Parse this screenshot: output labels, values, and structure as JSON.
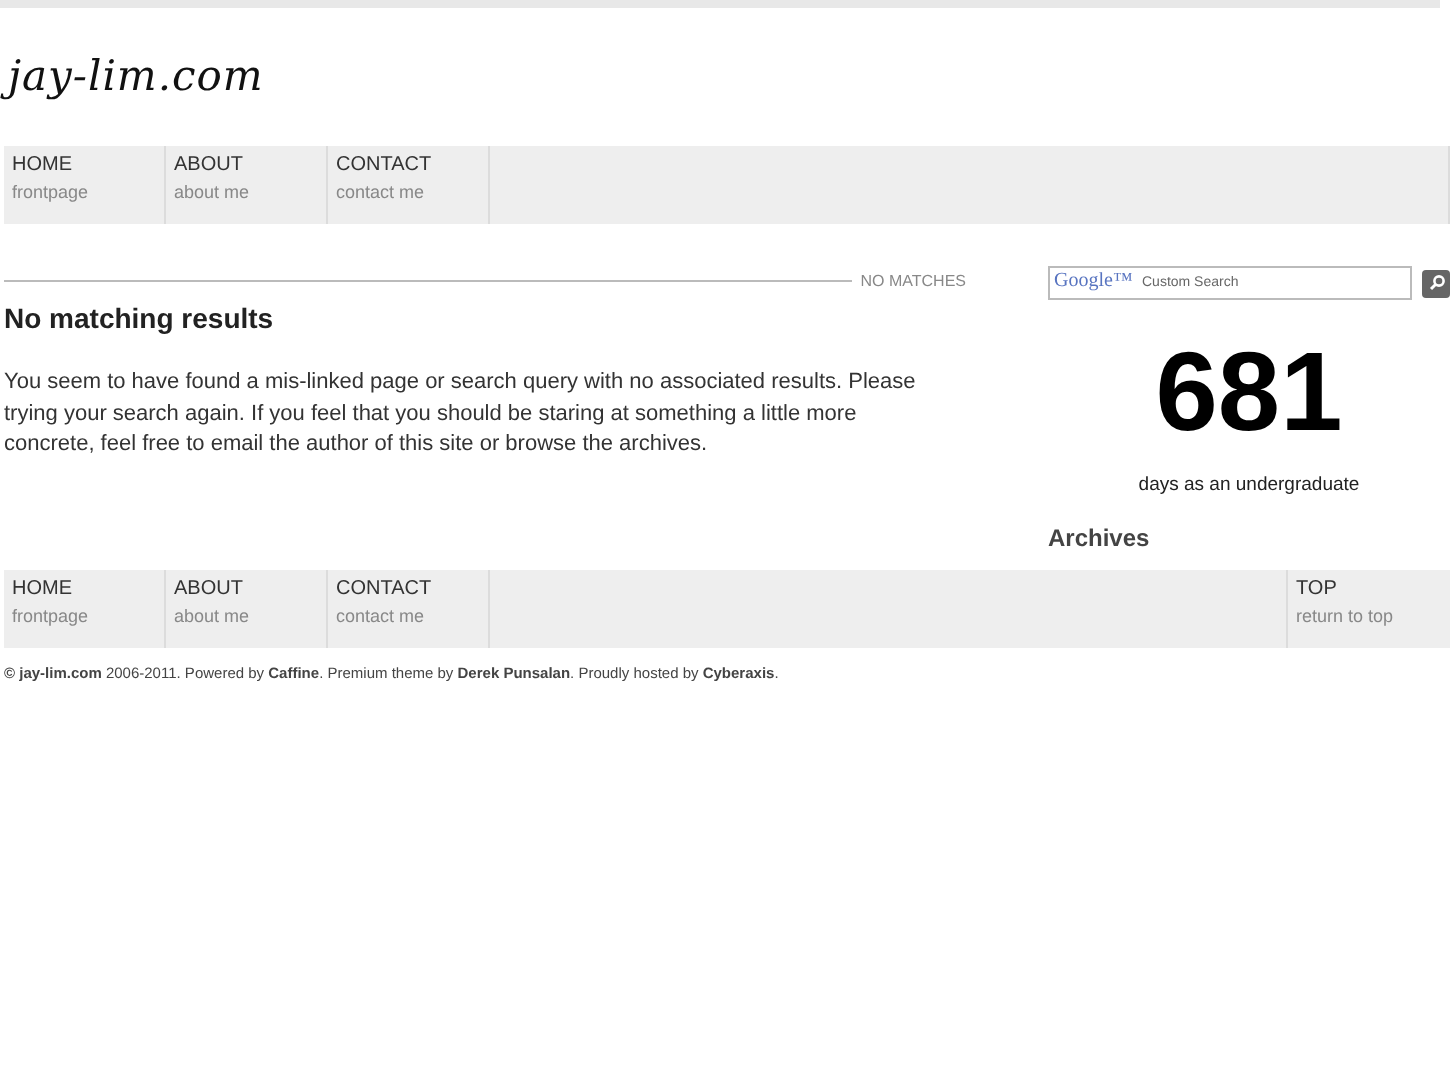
{
  "site": {
    "logo": "jay-lim.com"
  },
  "nav": [
    {
      "title": "HOME",
      "subtitle": "frontpage"
    },
    {
      "title": "ABOUT",
      "subtitle": "about me"
    },
    {
      "title": "CONTACT",
      "subtitle": "contact me"
    }
  ],
  "main": {
    "section_label": "NO MATCHES",
    "heading": "No matching results",
    "body": "You seem to have found a mis-linked page or search query with no associated results. Please trying your search again. If you feel that you should be staring at something a little more concrete, feel free to email the author of this site or browse the archives."
  },
  "sidebar": {
    "search": {
      "brand": "Google™",
      "placeholder": "Custom Search"
    },
    "counter": "681",
    "counter_caption": "days as an undergraduate",
    "archives_heading": "Archives"
  },
  "footer_nav": [
    {
      "title": "HOME",
      "subtitle": "frontpage"
    },
    {
      "title": "ABOUT",
      "subtitle": "about me"
    },
    {
      "title": "CONTACT",
      "subtitle": "contact me"
    }
  ],
  "footer_top": {
    "title": "TOP",
    "subtitle": "return to top"
  },
  "copyright": "**© jay-lim.com** 2006-2011. Powered by **Caffine**. Premium theme by **Derek Punsalan**. Proudly hosted by **Cyberaxis**."
}
